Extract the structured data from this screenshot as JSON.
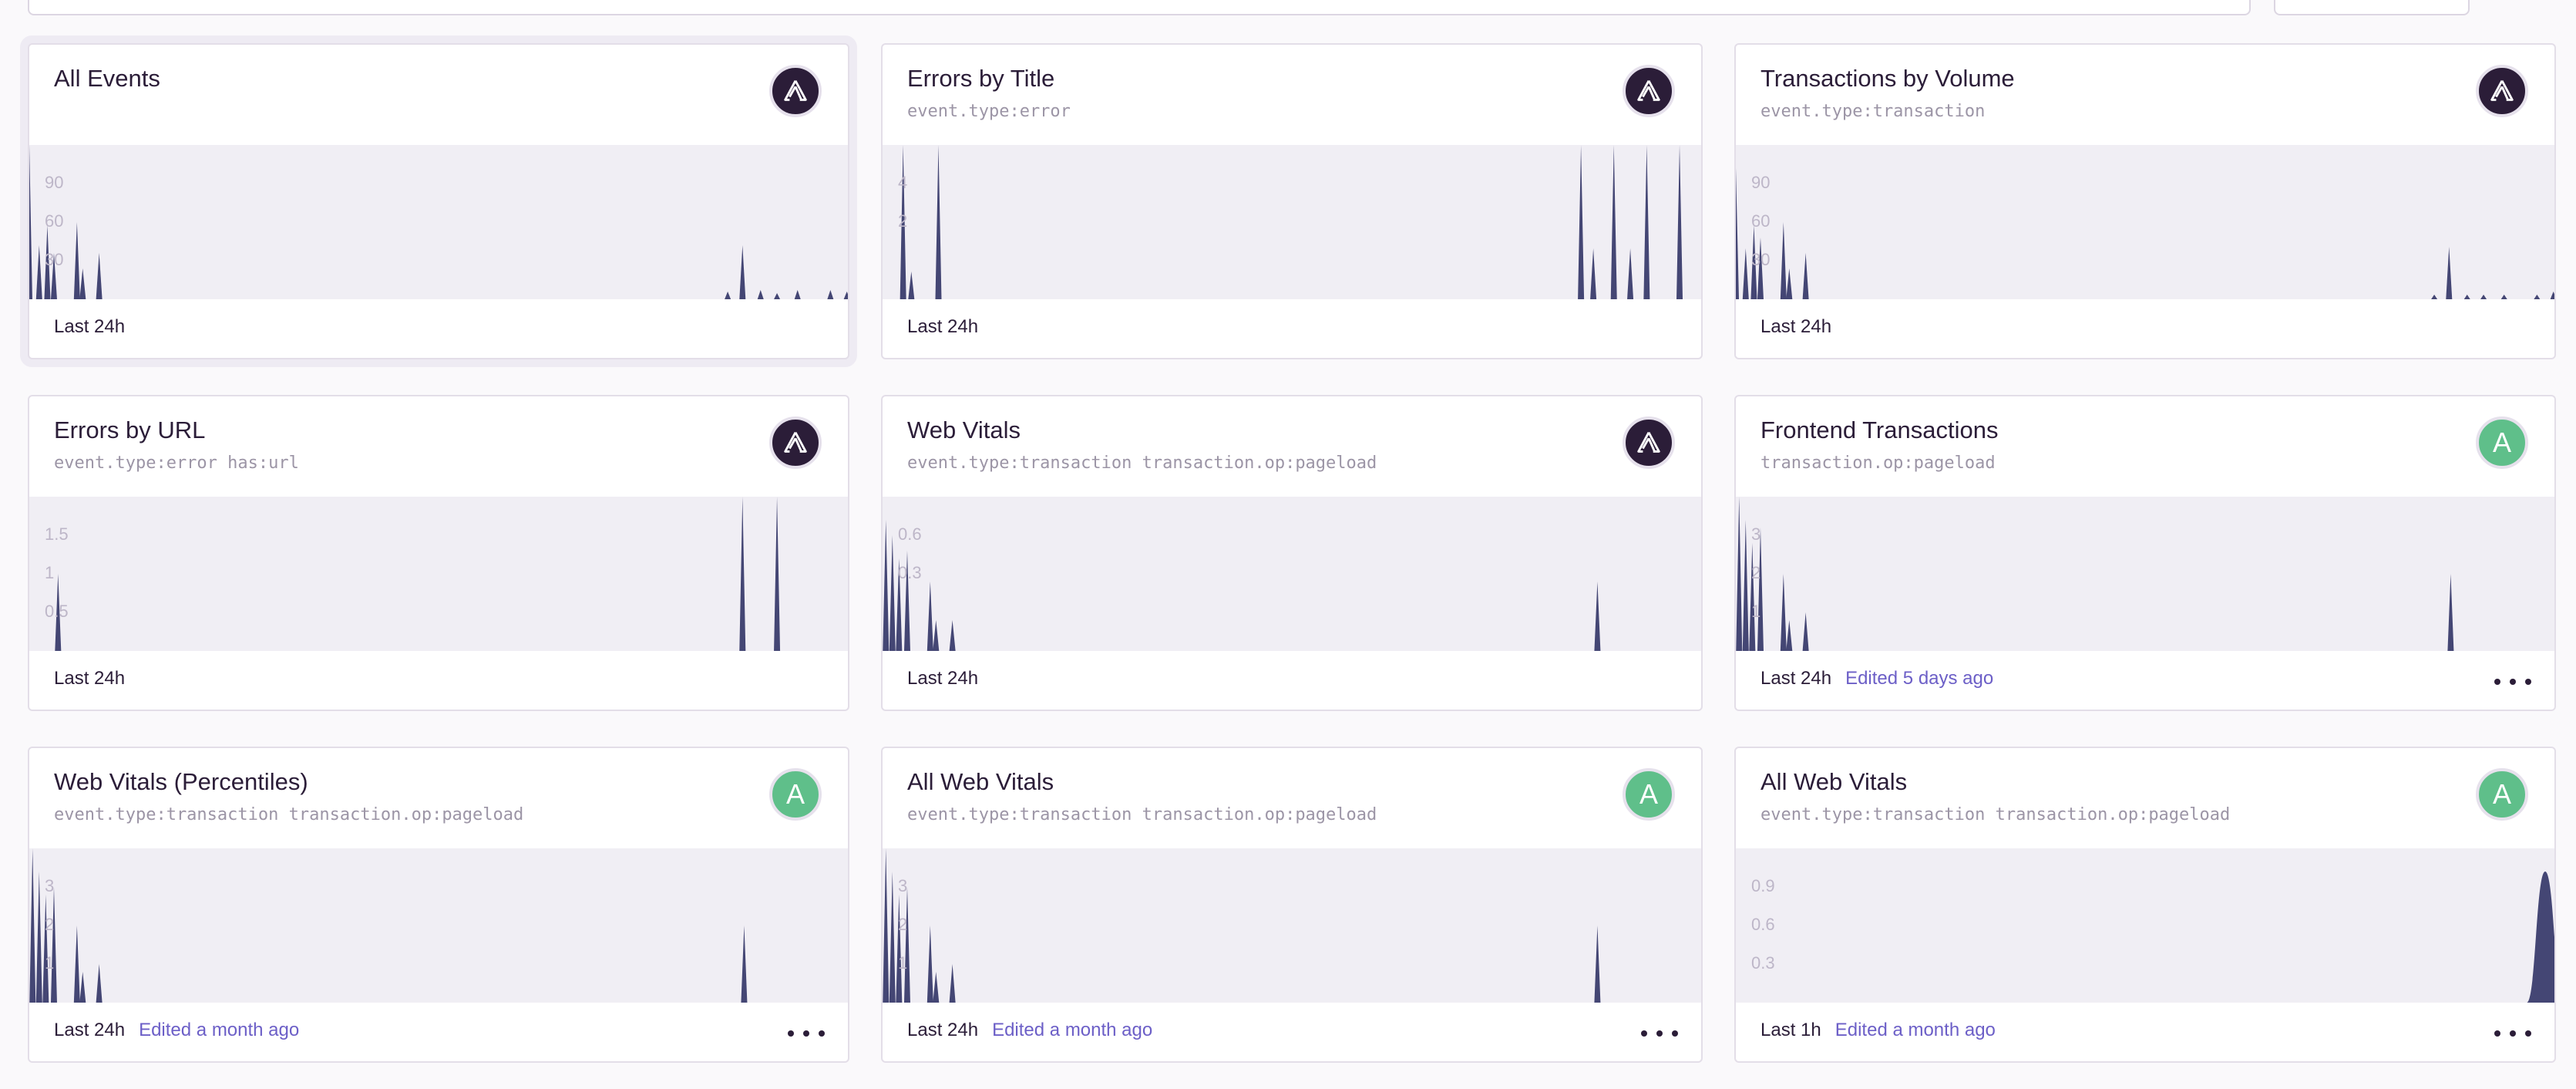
{
  "widgets": [
    {
      "title": "All Events",
      "query": "",
      "avatar": {
        "type": "logo",
        "icon": "sentry-logo-icon",
        "letter": ""
      },
      "ticks": [
        "90",
        "60",
        "30"
      ],
      "range": "Last 24h",
      "edited": "",
      "has_menu": false,
      "selected": true,
      "chart_data": {
        "type": "area",
        "title": "All Events",
        "x_range": "Last 24h",
        "ticks": [
          "90",
          "60",
          "30"
        ],
        "peaks": [
          [
            0.0,
            100
          ],
          [
            0.012,
            35
          ],
          [
            0.022,
            48
          ],
          [
            0.03,
            30
          ],
          [
            0.058,
            50
          ],
          [
            0.065,
            20
          ],
          [
            0.085,
            30
          ],
          [
            0.85,
            5
          ],
          [
            0.868,
            35
          ],
          [
            0.89,
            6
          ],
          [
            0.91,
            4
          ],
          [
            0.935,
            6
          ],
          [
            0.975,
            6
          ],
          [
            0.995,
            5
          ]
        ]
      }
    },
    {
      "title": "Errors by Title",
      "query": "event.type:error",
      "avatar": {
        "type": "logo",
        "icon": "sentry-logo-icon",
        "letter": ""
      },
      "ticks": [
        "4",
        "2"
      ],
      "range": "Last 24h",
      "edited": "",
      "has_menu": false,
      "selected": false,
      "chart_data": {
        "type": "area",
        "title": "Errors by Title",
        "x_range": "Last 24h",
        "ticks": [
          "4",
          "2"
        ],
        "peaks": [
          [
            0.025,
            100
          ],
          [
            0.035,
            18
          ],
          [
            0.068,
            100
          ],
          [
            0.85,
            100
          ],
          [
            0.865,
            33
          ],
          [
            0.89,
            100
          ],
          [
            0.91,
            33
          ],
          [
            0.93,
            100
          ],
          [
            0.97,
            100
          ]
        ]
      }
    },
    {
      "title": "Transactions by Volume",
      "query": "event.type:transaction",
      "avatar": {
        "type": "logo",
        "icon": "sentry-logo-icon",
        "letter": ""
      },
      "ticks": [
        "90",
        "60",
        "30"
      ],
      "range": "Last 24h",
      "edited": "",
      "has_menu": false,
      "selected": false,
      "chart_data": {
        "type": "area",
        "title": "Transactions by Volume",
        "x_range": "Last 24h",
        "ticks": [
          "90",
          "60",
          "30"
        ],
        "peaks": [
          [
            0.0,
            85
          ],
          [
            0.012,
            33
          ],
          [
            0.022,
            48
          ],
          [
            0.03,
            40
          ],
          [
            0.058,
            50
          ],
          [
            0.065,
            20
          ],
          [
            0.085,
            30
          ],
          [
            0.85,
            3
          ],
          [
            0.868,
            34
          ],
          [
            0.89,
            3
          ],
          [
            0.91,
            3
          ],
          [
            0.935,
            3
          ],
          [
            0.975,
            3
          ],
          [
            0.995,
            5
          ]
        ]
      }
    },
    {
      "title": "Errors by URL",
      "query": "event.type:error has:url",
      "avatar": {
        "type": "logo",
        "icon": "sentry-logo-icon",
        "letter": ""
      },
      "ticks": [
        "1.5",
        "1",
        "0.5"
      ],
      "range": "Last 24h",
      "edited": "",
      "has_menu": false,
      "selected": false,
      "chart_data": {
        "type": "area",
        "title": "Errors by URL",
        "x_range": "Last 24h",
        "ticks": [
          "1.5",
          "1",
          "0.5"
        ],
        "peaks": [
          [
            0.035,
            50
          ],
          [
            0.868,
            100
          ],
          [
            0.91,
            100
          ]
        ]
      }
    },
    {
      "title": "Web Vitals",
      "query": "event.type:transaction transaction.op:pageload",
      "avatar": {
        "type": "logo",
        "icon": "sentry-logo-icon",
        "letter": ""
      },
      "ticks": [
        "0.6",
        "0.3"
      ],
      "range": "Last 24h",
      "edited": "",
      "has_menu": false,
      "selected": false,
      "chart_data": {
        "type": "area",
        "title": "Web Vitals",
        "x_range": "Last 24h",
        "ticks": [
          "0.6",
          "0.3"
        ],
        "peaks": [
          [
            0.004,
            85
          ],
          [
            0.012,
            75
          ],
          [
            0.02,
            60
          ],
          [
            0.03,
            65
          ],
          [
            0.058,
            45
          ],
          [
            0.065,
            20
          ],
          [
            0.085,
            20
          ],
          [
            0.87,
            45
          ]
        ]
      }
    },
    {
      "title": "Frontend Transactions",
      "query": "transaction.op:pageload",
      "avatar": {
        "type": "letter",
        "icon": "",
        "letter": "A"
      },
      "ticks": [
        "3",
        "2",
        "1"
      ],
      "range": "Last 24h",
      "edited": "Edited 5 days ago",
      "has_menu": true,
      "selected": false,
      "chart_data": {
        "type": "area",
        "title": "Frontend Transactions",
        "x_range": "Last 24h",
        "ticks": [
          "3",
          "2",
          "1"
        ],
        "peaks": [
          [
            0.004,
            100
          ],
          [
            0.012,
            85
          ],
          [
            0.02,
            70
          ],
          [
            0.03,
            80
          ],
          [
            0.058,
            50
          ],
          [
            0.065,
            20
          ],
          [
            0.085,
            25
          ],
          [
            0.87,
            50
          ]
        ]
      }
    },
    {
      "title": "Web Vitals (Percentiles)",
      "query": "event.type:transaction transaction.op:pageload",
      "avatar": {
        "type": "letter",
        "icon": "",
        "letter": "A"
      },
      "ticks": [
        "3",
        "2",
        "1"
      ],
      "range": "Last 24h",
      "edited": "Edited a month ago",
      "has_menu": true,
      "selected": false,
      "chart_data": {
        "type": "area",
        "title": "Web Vitals (Percentiles)",
        "x_range": "Last 24h",
        "ticks": [
          "3",
          "2",
          "1"
        ],
        "peaks": [
          [
            0.004,
            100
          ],
          [
            0.012,
            85
          ],
          [
            0.02,
            70
          ],
          [
            0.03,
            75
          ],
          [
            0.058,
            50
          ],
          [
            0.065,
            20
          ],
          [
            0.085,
            25
          ],
          [
            0.87,
            50
          ]
        ]
      }
    },
    {
      "title": "All Web Vitals",
      "query": "event.type:transaction transaction.op:pageload",
      "avatar": {
        "type": "letter",
        "icon": "",
        "letter": "A"
      },
      "ticks": [
        "3",
        "2",
        "1"
      ],
      "range": "Last 24h",
      "edited": "Edited a month ago",
      "has_menu": true,
      "selected": false,
      "chart_data": {
        "type": "area",
        "title": "All Web Vitals",
        "x_range": "Last 24h",
        "ticks": [
          "3",
          "2",
          "1"
        ],
        "peaks": [
          [
            0.004,
            100
          ],
          [
            0.012,
            85
          ],
          [
            0.02,
            70
          ],
          [
            0.03,
            75
          ],
          [
            0.058,
            50
          ],
          [
            0.065,
            20
          ],
          [
            0.085,
            25
          ],
          [
            0.87,
            50
          ]
        ]
      }
    },
    {
      "title": "All Web Vitals",
      "query": "event.type:transaction transaction.op:pageload",
      "avatar": {
        "type": "letter",
        "icon": "",
        "letter": "A"
      },
      "ticks": [
        "0.9",
        "0.6",
        "0.3"
      ],
      "range": "Last 1h",
      "edited": "Edited a month ago",
      "has_menu": true,
      "selected": false,
      "chart_data": {
        "type": "area",
        "title": "All Web Vitals",
        "x_range": "Last 1h",
        "ticks": [
          "0.9",
          "0.6",
          "0.3"
        ],
        "peaks": [
          [
            0.985,
            85
          ]
        ],
        "wide_peak": true
      }
    }
  ],
  "colors": {
    "area_fill": "#444674",
    "accent": "#6c5fc7",
    "avatar_green": "#5fbf8a",
    "avatar_dark": "#2b1d38"
  }
}
